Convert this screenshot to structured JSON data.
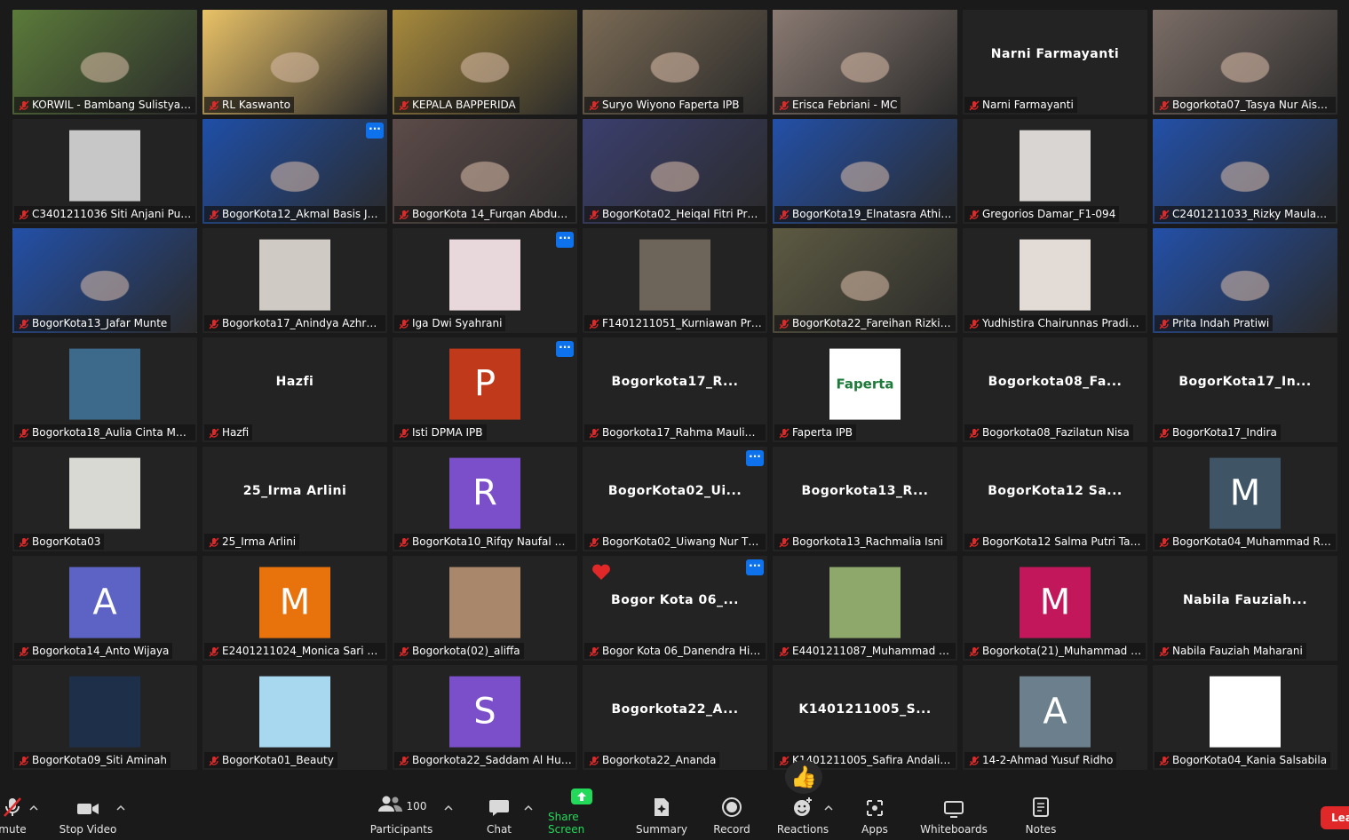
{
  "colors": {
    "accent": "#c9e265",
    "more_button": "#0e72ed",
    "share_screen": "#23d959",
    "leave": "#e02828"
  },
  "tiles": [
    {
      "name": "KORWIL - Bambang Sulistyant...",
      "bg": "#5b7a3a",
      "kind": "video"
    },
    {
      "name": "RL Kaswanto",
      "bg": "#e9c267",
      "kind": "video"
    },
    {
      "name": "KEPALA BAPPERIDA",
      "bg": "#a78a3c",
      "kind": "video"
    },
    {
      "name": "Suryo Wiyono Faperta IPB",
      "bg": "#7a6a54",
      "kind": "video"
    },
    {
      "name": "Erisca Febriani - MC",
      "bg": "#8a7a72",
      "kind": "video",
      "active": true
    },
    {
      "name": "Narni Farmayanti",
      "big": "Narni Farmayanti",
      "kind": "name"
    },
    {
      "name": "Bogorkota07_Tasya Nur Aisyah",
      "bg": "#7b6d66",
      "kind": "video"
    },
    {
      "name": "C3401211036 Siti Anjani Putri",
      "bg": "#c7c7c7",
      "kind": "thumb"
    },
    {
      "name": "BogorKota12_Akmal Basis Jati...",
      "bg": "#1f4fa8",
      "kind": "video",
      "more": true
    },
    {
      "name": "BogorKota 14_Furqan Abduss...",
      "bg": "#5c4b49",
      "kind": "video"
    },
    {
      "name": "BogorKota02_Heiqal Fitri Pra...",
      "bg": "#3b3f6e",
      "kind": "video"
    },
    {
      "name": "BogorKota19_Elnatasra Athilla...",
      "bg": "#2350a8",
      "kind": "video"
    },
    {
      "name": "Gregorios Damar_F1-094",
      "bg": "#d8d5d3",
      "kind": "thumb"
    },
    {
      "name": "C2401211033_Rizky Maulana ...",
      "bg": "#2350a8",
      "kind": "video"
    },
    {
      "name": "BogorKota13_Jafar Munte",
      "bg": "#2350a8",
      "kind": "video",
      "active_white": true
    },
    {
      "name": "Bogorkota17_Anindya Azhra P...",
      "bg": "#cfcac4",
      "kind": "thumb"
    },
    {
      "name": "Iga Dwi Syahrani",
      "bg": "#e8d8dc",
      "kind": "thumb",
      "more": true
    },
    {
      "name": "F1401211051_Kurniawan Praw...",
      "bg": "#6e655a",
      "kind": "thumb"
    },
    {
      "name": "BogorKota22_Fareihan Rizki F...",
      "bg": "#5d5a42",
      "kind": "video"
    },
    {
      "name": "Yudhistira Chairunnas Pradiva...",
      "bg": "#e3dcd6",
      "kind": "thumb"
    },
    {
      "name": "Prita Indah Pratiwi",
      "bg": "#2350a8",
      "kind": "video"
    },
    {
      "name": "Bogorkota18_Aulia Cinta Mah...",
      "bg": "#3d6a8a",
      "kind": "thumb"
    },
    {
      "name": "Hazfi",
      "big": "Hazfi",
      "kind": "name"
    },
    {
      "name": "Isti DPMA IPB",
      "letter": "P",
      "bg": "#c0391b",
      "kind": "avatar",
      "more": true
    },
    {
      "name": "Bogorkota17_Rahma Maulidya",
      "big": "Bogorkota17_R...",
      "kind": "name"
    },
    {
      "name": "Faperta IPB",
      "bg": "#ffffff",
      "kind": "thumb",
      "logo": "Faperta"
    },
    {
      "name": "Bogorkota08_Fazilatun Nisa",
      "big": "Bogorkota08_Fa...",
      "kind": "name"
    },
    {
      "name": "BogorKota17_Indira",
      "big": "BogorKota17_In...",
      "kind": "name"
    },
    {
      "name": "BogorKota03",
      "bg": "#d9d9d4",
      "kind": "thumb"
    },
    {
      "name": "25_Irma Arlini",
      "big": "25_Irma Arlini",
      "kind": "name"
    },
    {
      "name": "BogorKota10_Rifqy Naufal Az...",
      "letter": "R",
      "bg": "#7b4fc9",
      "kind": "avatar"
    },
    {
      "name": "BogorKota02_Uiwang Nur Th...",
      "big": "BogorKota02_Ui...",
      "kind": "name",
      "more": true
    },
    {
      "name": "Bogorkota13_Rachmalia Isni",
      "big": "Bogorkota13_R...",
      "kind": "name"
    },
    {
      "name": "BogorKota12 Salma Putri Tau...",
      "big": "BogorKota12 Sa...",
      "kind": "name"
    },
    {
      "name": "BogorKota04_Muhammad Riz...",
      "letter": "M",
      "bg": "#3f5566",
      "kind": "avatar"
    },
    {
      "name": "Bogorkota14_Anto Wijaya",
      "letter": "A",
      "bg": "#5c63c4",
      "kind": "avatar"
    },
    {
      "name": "E2401211024_Monica Sari Ani",
      "letter": "M",
      "bg": "#e8730c",
      "kind": "avatar"
    },
    {
      "name": "Bogorkota(02)_aliffa",
      "bg": "#a9876a",
      "kind": "thumb"
    },
    {
      "name": "Bogor Kota 06_Danendra Hid...",
      "big": "Bogor Kota 06_...",
      "kind": "name",
      "more": true,
      "heart": true
    },
    {
      "name": "E4401211087_Muhammad Riz...",
      "bg": "#8da86a",
      "kind": "thumb"
    },
    {
      "name": "Bogorkota(21)_Muhammad W...",
      "letter": "M",
      "bg": "#c2185b",
      "kind": "avatar"
    },
    {
      "name": "Nabila Fauziah Maharani",
      "big": "Nabila  Fauziah...",
      "kind": "name"
    },
    {
      "name": "BogorKota09_Siti Aminah",
      "bg": "#1e2f4a",
      "kind": "thumb"
    },
    {
      "name": "BogorKota01_Beauty",
      "bg": "#a8d8ef",
      "kind": "thumb"
    },
    {
      "name": "Bogorkota22_Saddam Al Hus...",
      "letter": "S",
      "bg": "#7b4fc9",
      "kind": "avatar"
    },
    {
      "name": "Bogorkota22_Ananda",
      "big": "Bogorkota22_A...",
      "kind": "name"
    },
    {
      "name": "K1401211005_Safira Andalian...",
      "big": "K1401211005_S...",
      "kind": "name"
    },
    {
      "name": "14-2-Ahmad Yusuf Ridho",
      "letter": "A",
      "bg": "#6c7f8c",
      "kind": "avatar"
    },
    {
      "name": "BogorKota04_Kania Salsabila",
      "bg": "#ffffff",
      "kind": "thumb"
    }
  ],
  "toolbar": {
    "unmute": "mute",
    "stop_video": "Stop Video",
    "participants": "Participants",
    "participant_count": "100",
    "chat": "Chat",
    "share_screen": "Share Screen",
    "summary": "Summary",
    "record": "Record",
    "reactions": "Reactions",
    "apps": "Apps",
    "whiteboards": "Whiteboards",
    "notes": "Notes",
    "leave": "Lea"
  },
  "reaction_emoji": "👍",
  "more_glyph": "···",
  "icons": {
    "mic_muted": "mic-muted-icon",
    "video": "video-camera-icon",
    "participants": "participants-icon",
    "chat": "chat-bubble-icon",
    "share": "share-screen-icon",
    "summary": "summary-sparkle-icon",
    "record": "record-icon",
    "reactions": "reactions-icon",
    "apps": "apps-icon",
    "whiteboards": "whiteboard-icon",
    "notes": "notes-icon"
  }
}
